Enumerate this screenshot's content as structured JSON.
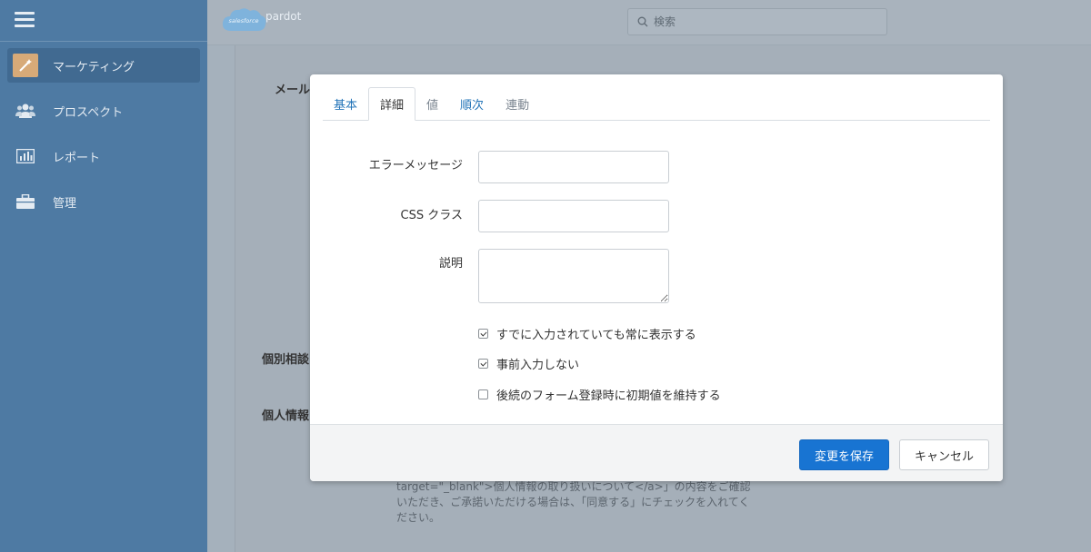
{
  "sidebar": {
    "items": [
      {
        "label": "マーケティング",
        "icon": "wand-icon"
      },
      {
        "label": "プロスペクト",
        "icon": "users-icon"
      },
      {
        "label": "レポート",
        "icon": "chart-icon"
      },
      {
        "label": "管理",
        "icon": "briefcase-icon"
      }
    ]
  },
  "header": {
    "logo_cloud_text": "salesforce",
    "logo_text": "pardot",
    "search_placeholder": "検索"
  },
  "background": {
    "label_mail": "メール",
    "label_consult": "個別相談",
    "label_privacy": "個人情報",
    "notice": "target=\"_blank\">個人情報の取り扱いについて</a>」の内容をご確認いただき、ご承諾いただける場合は、「同意する」にチェックを入れてください。"
  },
  "modal": {
    "tabs": [
      {
        "label": "基本"
      },
      {
        "label": "詳細"
      },
      {
        "label": "値"
      },
      {
        "label": "順次"
      },
      {
        "label": "連動"
      }
    ],
    "fields": {
      "error_message_label": "エラーメッセージ",
      "error_message_value": "",
      "css_class_label": "CSS クラス",
      "css_class_value": "",
      "description_label": "説明",
      "description_value": ""
    },
    "checkboxes": [
      {
        "label": "すでに入力されていても常に表示する",
        "checked": true
      },
      {
        "label": "事前入力しない",
        "checked": true
      },
      {
        "label": "後続のフォーム登録時に初期値を維持する",
        "checked": false
      }
    ],
    "footer": {
      "save_label": "変更を保存",
      "cancel_label": "キャンセル"
    }
  },
  "colors": {
    "sidebar": "#4e7aa3",
    "primary_button": "#1874d2",
    "tab_link": "#2374b8"
  }
}
